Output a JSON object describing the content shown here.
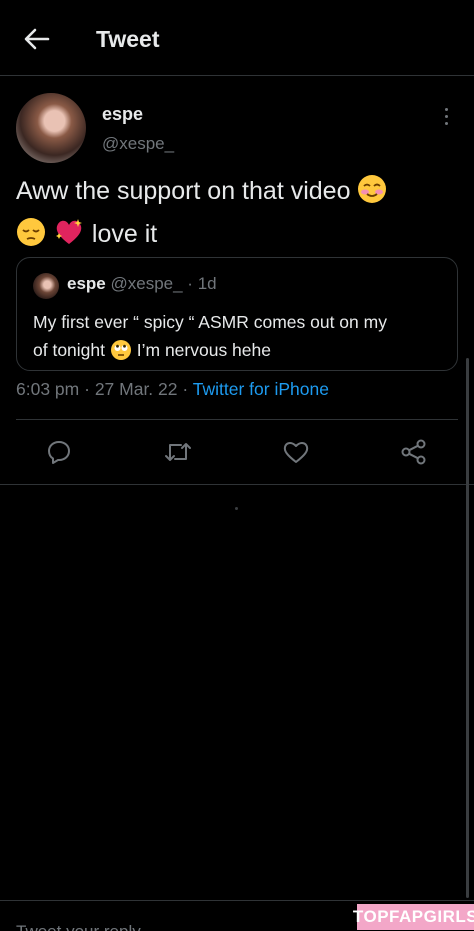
{
  "header": {
    "back_icon": "arrow-left-icon",
    "title": "Tweet"
  },
  "tweet": {
    "author_name": "espe",
    "author_handle": "@xespe_",
    "text_line1": "Aww the support on that video",
    "text_line2": "love it",
    "emojis": [
      "smiling-blush-emoji",
      "relieved-emoji",
      "sparkling-heart-emoji"
    ],
    "timestamp": "6:03 pm",
    "date": "27 Mar. 22",
    "source": "Twitter for iPhone"
  },
  "quote": {
    "author_name": "espe",
    "author_handle": "@xespe_",
    "age": "1d",
    "text_line1": "My first ever “ spicy “ ASMR comes out on my",
    "text_line2_a": "of tonight",
    "text_line2_b": "I’m nervous hehe",
    "emoji": "rolling-eyes-emoji"
  },
  "actions": [
    {
      "name": "reply",
      "icon": "reply-icon"
    },
    {
      "name": "retweet",
      "icon": "retweet-icon"
    },
    {
      "name": "like",
      "icon": "heart-icon"
    },
    {
      "name": "share",
      "icon": "share-icon"
    }
  ],
  "reply_bar": {
    "placeholder": "Tweet your reply"
  },
  "watermark": {
    "text": "TOPFAPGIRLS"
  },
  "colors": {
    "background": "#000000",
    "text": "#e7e9ea",
    "secondary": "#71767b",
    "accent": "#1d9bf0",
    "border": "#2f3336",
    "watermark": "#f3a7c8"
  }
}
